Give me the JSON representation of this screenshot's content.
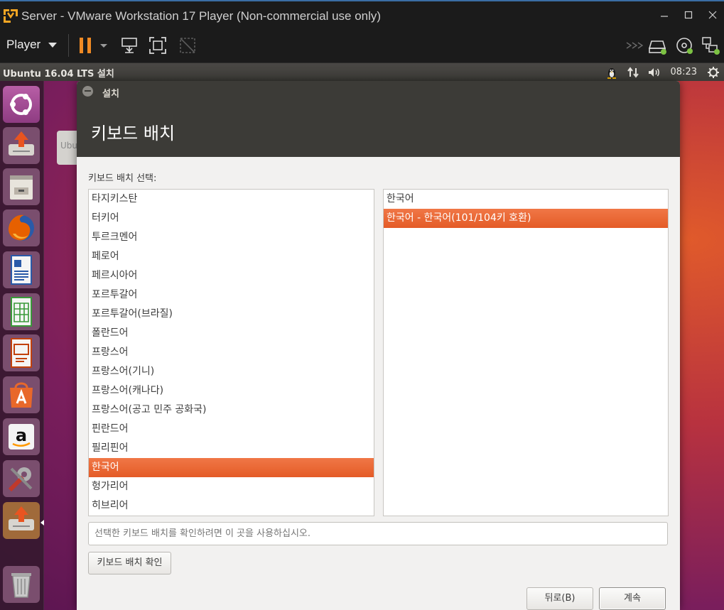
{
  "vmware": {
    "title": "Server - VMware Workstation 17 Player (Non-commercial use only)",
    "player_menu": "Player",
    "toolbar_icons": [
      "pause-icon",
      "send-ctrl-alt-del-icon",
      "fit-guest-icon",
      "unity-icon",
      "forward-icon",
      "hdd-icon",
      "cd-icon",
      "network-icon"
    ],
    "status_colors": {
      "active": "#7cc243",
      "pause": "#f08a24"
    }
  },
  "ubuntu_panel": {
    "title": "Ubuntu 16.04 LTS 설치",
    "clock": "08:23"
  },
  "launcher": {
    "items": [
      "ubuntu-dash-icon",
      "installer-icon",
      "files-icon",
      "firefox-icon",
      "writer-icon",
      "calc-icon",
      "impress-icon",
      "software-center-icon",
      "amazon-icon",
      "system-settings-icon",
      "installer-running-icon",
      "trash-icon"
    ]
  },
  "desktop": {
    "ghost_text": "Ubu"
  },
  "installer": {
    "window_title": "설치",
    "heading": "키보드 배치",
    "layout_label": "키보드 배치 선택:",
    "layouts": [
      {
        "label": "타지키스탄",
        "selected": false
      },
      {
        "label": "터키어",
        "selected": false
      },
      {
        "label": "투르크멘어",
        "selected": false
      },
      {
        "label": "페로어",
        "selected": false
      },
      {
        "label": "페르시아어",
        "selected": false
      },
      {
        "label": "포르투갈어",
        "selected": false
      },
      {
        "label": "포르투갈어(브라질)",
        "selected": false
      },
      {
        "label": "폴란드어",
        "selected": false
      },
      {
        "label": "프랑스어",
        "selected": false
      },
      {
        "label": "프랑스어(기니)",
        "selected": false
      },
      {
        "label": "프랑스어(캐나다)",
        "selected": false
      },
      {
        "label": "프랑스어(공고 민주 공화국)",
        "selected": false
      },
      {
        "label": "핀란드어",
        "selected": false
      },
      {
        "label": "필리핀어",
        "selected": false
      },
      {
        "label": "한국어",
        "selected": true
      },
      {
        "label": "헝가리어",
        "selected": false
      },
      {
        "label": "히브리어",
        "selected": false
      }
    ],
    "variants": [
      {
        "label": "한국어",
        "selected": false
      },
      {
        "label": "한국어 - 한국어(101/104키 호환)",
        "selected": true
      }
    ],
    "test_placeholder": "선택한 키보드 배치를 확인하려면 이 곳을 사용하십시오.",
    "detect_button": "키보드 배치 확인",
    "back_button": "뒤로(B)",
    "next_button": "계속",
    "accent_color": "#e9632f"
  }
}
